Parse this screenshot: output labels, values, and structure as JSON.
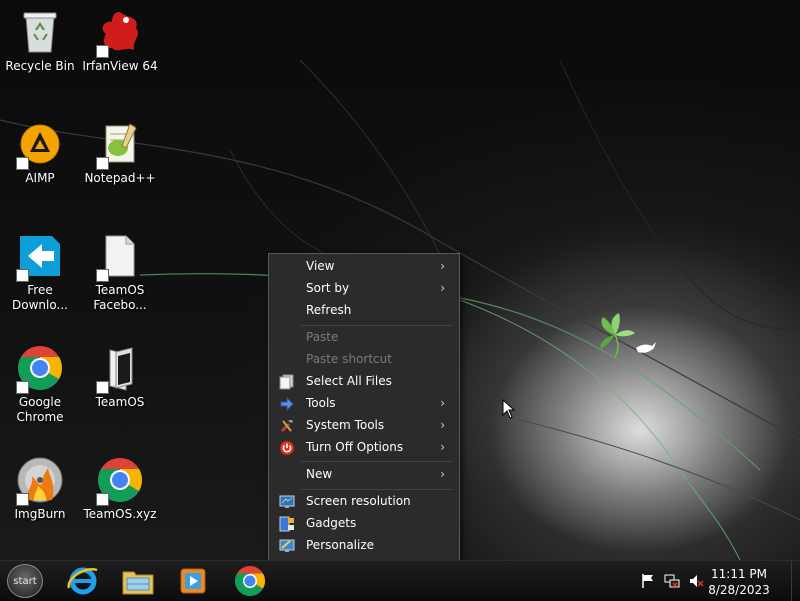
{
  "desktop": {
    "icons": [
      {
        "label": "Recycle Bin",
        "icon": "recycle-bin-icon"
      },
      {
        "label": "IrfanView 64",
        "icon": "irfanview-icon"
      },
      {
        "label": "AIMP",
        "icon": "aimp-icon"
      },
      {
        "label": "Notepad++",
        "icon": "notepadpp-icon"
      },
      {
        "label": "Free Downlo...",
        "icon": "free-download-manager-icon"
      },
      {
        "label": "TeamOS Facebo...",
        "icon": "file-icon"
      },
      {
        "label": "Google Chrome",
        "icon": "chrome-icon"
      },
      {
        "label": "TeamOS",
        "icon": "folder-icon"
      },
      {
        "label": "ImgBurn",
        "icon": "imgburn-icon"
      },
      {
        "label": "TeamOS.xyz",
        "icon": "chrome-icon"
      }
    ]
  },
  "context_menu": {
    "items": [
      {
        "label": "View",
        "submenu": true
      },
      {
        "label": "Sort by",
        "submenu": true
      },
      {
        "label": "Refresh"
      },
      {
        "label": "Paste",
        "disabled": true
      },
      {
        "label": "Paste shortcut",
        "disabled": true
      },
      {
        "label": "Select All Files",
        "icon": "select-all-icon"
      },
      {
        "label": "Tools",
        "icon": "tools-arrow-icon",
        "submenu": true
      },
      {
        "label": "System Tools",
        "icon": "system-tools-icon",
        "submenu": true
      },
      {
        "label": "Turn Off Options",
        "icon": "power-icon",
        "submenu": true
      },
      {
        "label": "New",
        "submenu": true
      },
      {
        "label": "Screen resolution",
        "icon": "screen-resolution-icon"
      },
      {
        "label": "Gadgets",
        "icon": "gadgets-icon"
      },
      {
        "label": "Personalize",
        "icon": "personalize-icon"
      }
    ],
    "submenu_glyph": "›"
  },
  "taskbar": {
    "start_label": "start",
    "pinned": [
      "internet-explorer-icon",
      "file-explorer-icon",
      "media-player-icon",
      "chrome-icon"
    ],
    "tray": [
      "action-center-flag-icon",
      "network-icon",
      "volume-muted-icon"
    ],
    "clock": {
      "time": "11:11 PM",
      "date": "8/28/2023"
    }
  }
}
